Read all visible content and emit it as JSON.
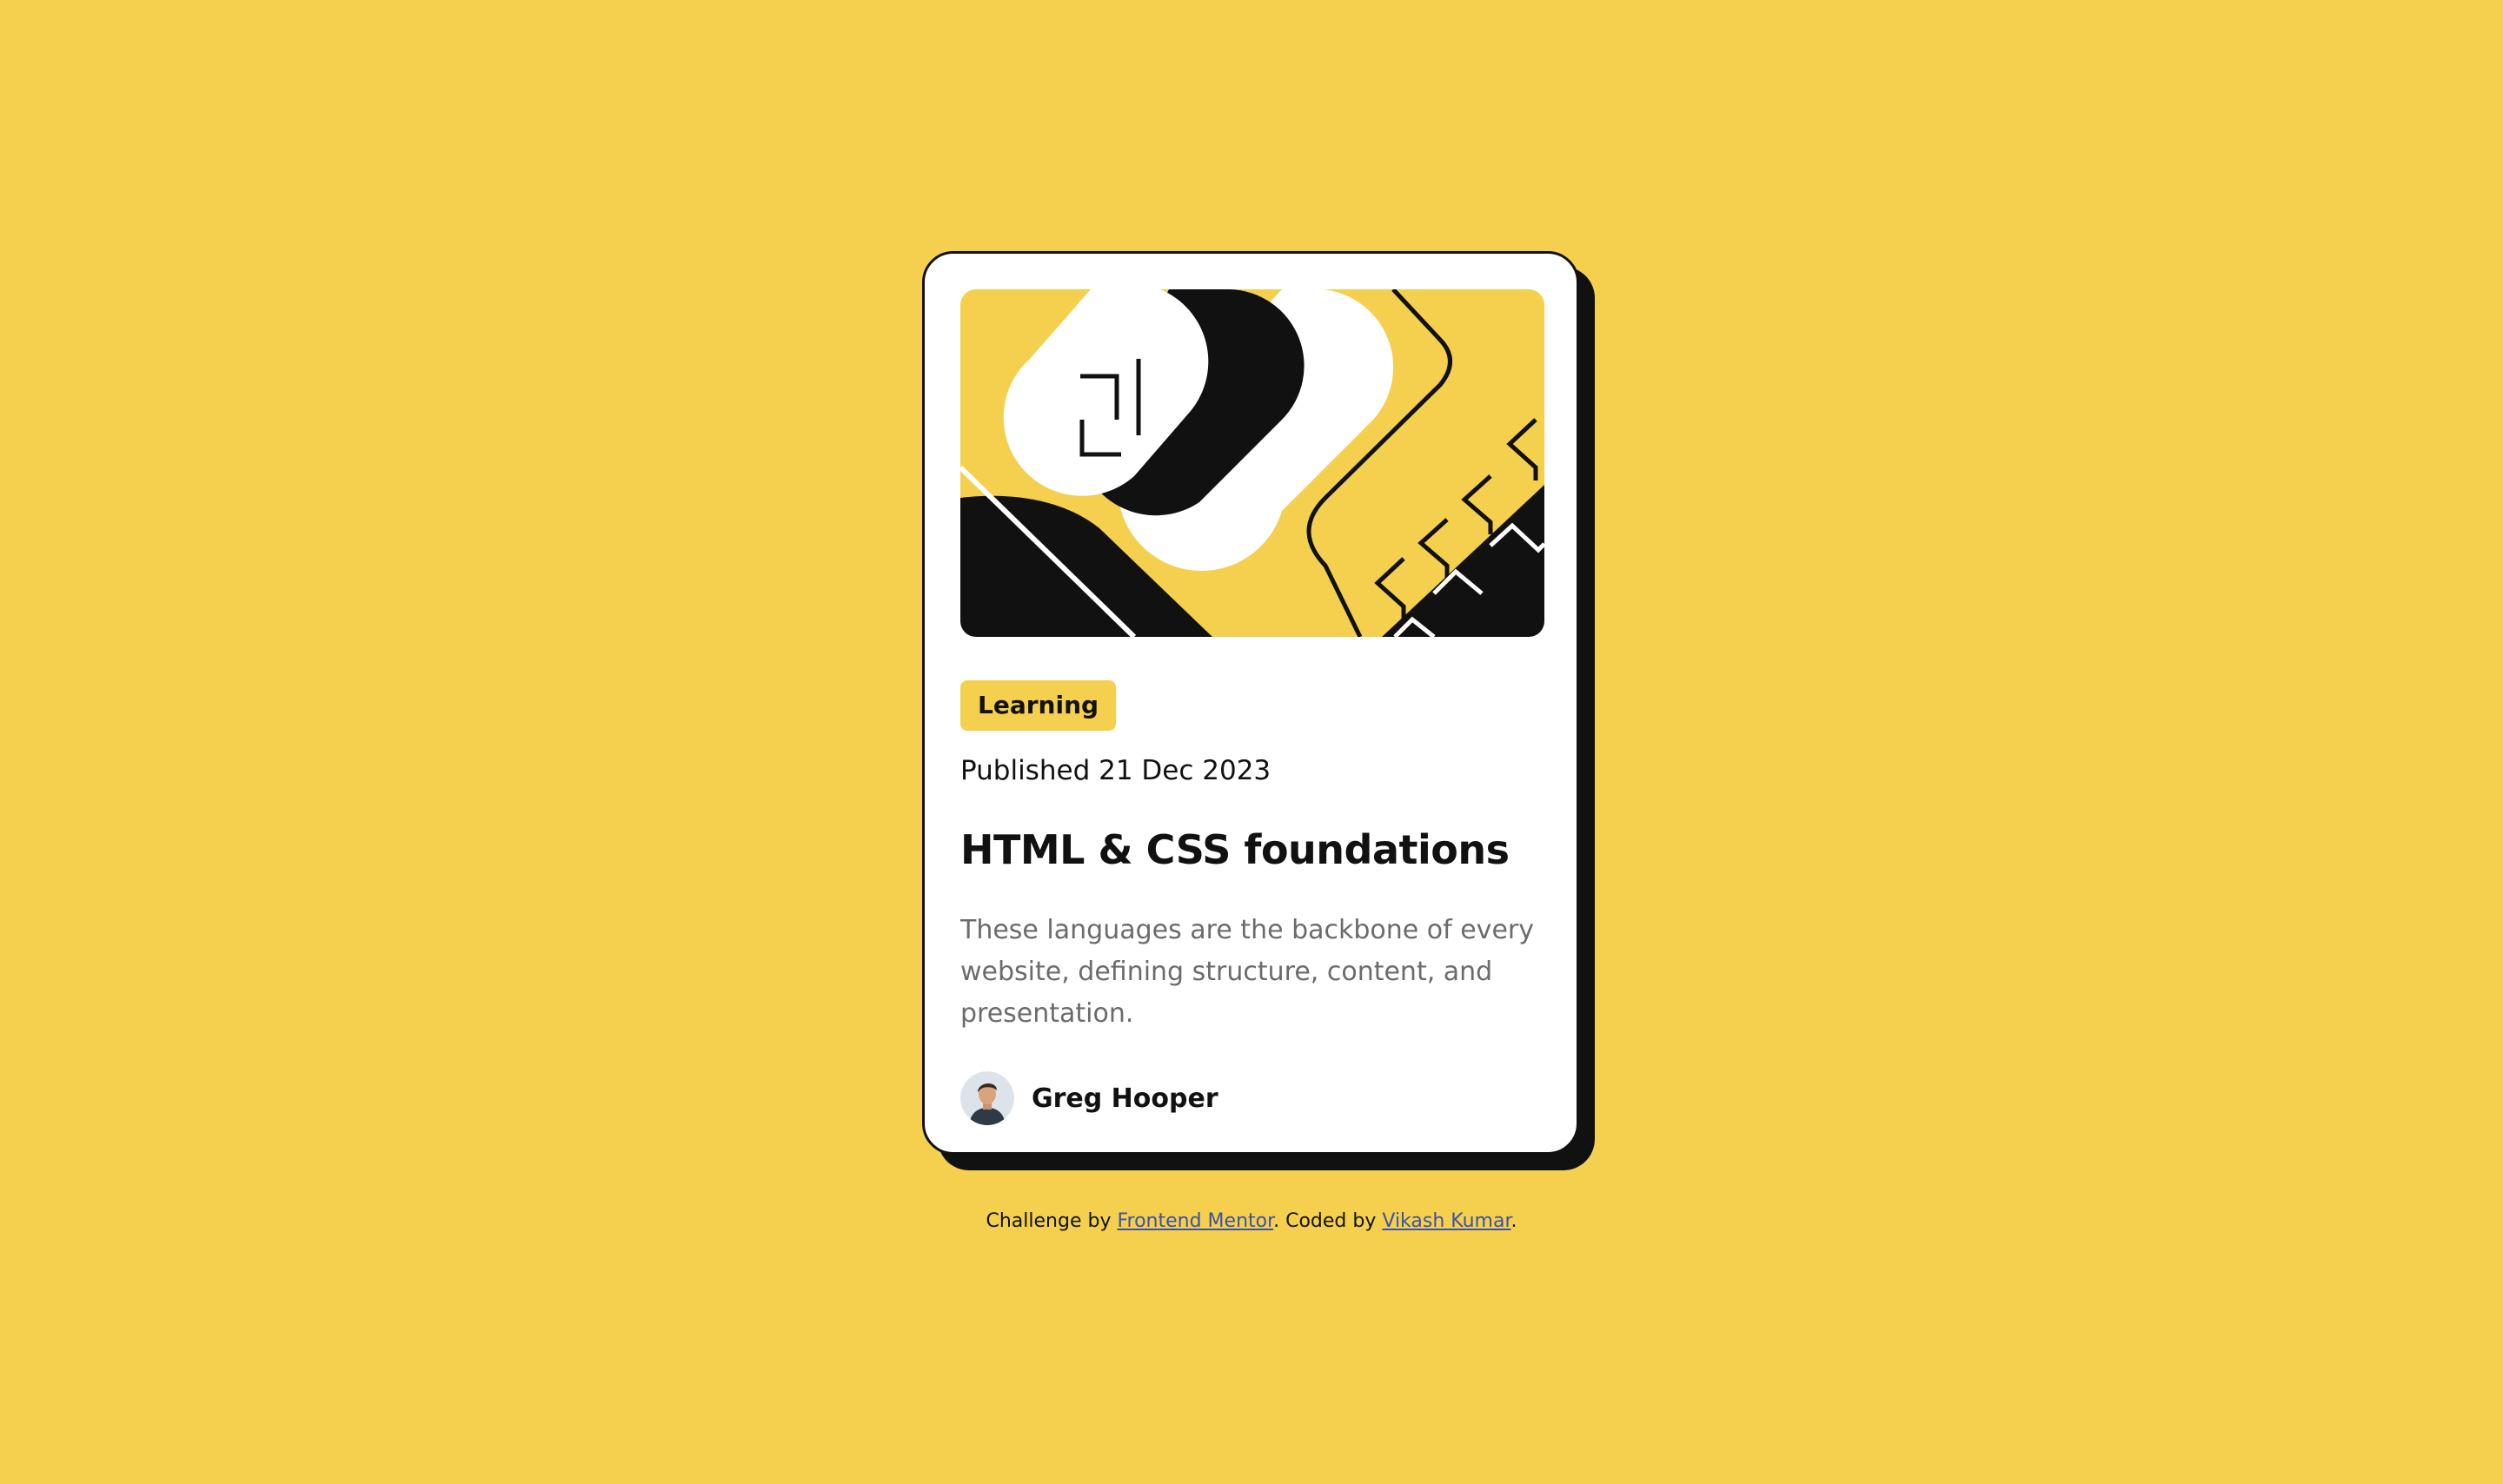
{
  "colors": {
    "background": "#F4D04E",
    "card": "#FFFFFF",
    "ink": "#111111",
    "muted_text": "#6B6B6B",
    "link": "#3E52A3"
  },
  "card": {
    "hero_image": "hero-illustration",
    "tag": "Learning",
    "published": "Published 21 Dec 2023",
    "title": "HTML & CSS foundations",
    "description": "These languages are the backbone of every website, defining structure, content, and presentation.",
    "author": {
      "avatar": "avatar-photo",
      "name": "Greg Hooper"
    }
  },
  "footer": {
    "prefix": "Challenge by ",
    "link1": "Frontend Mentor",
    "middle": ". Coded by ",
    "link2": "Vikash Kumar",
    "suffix": "."
  }
}
